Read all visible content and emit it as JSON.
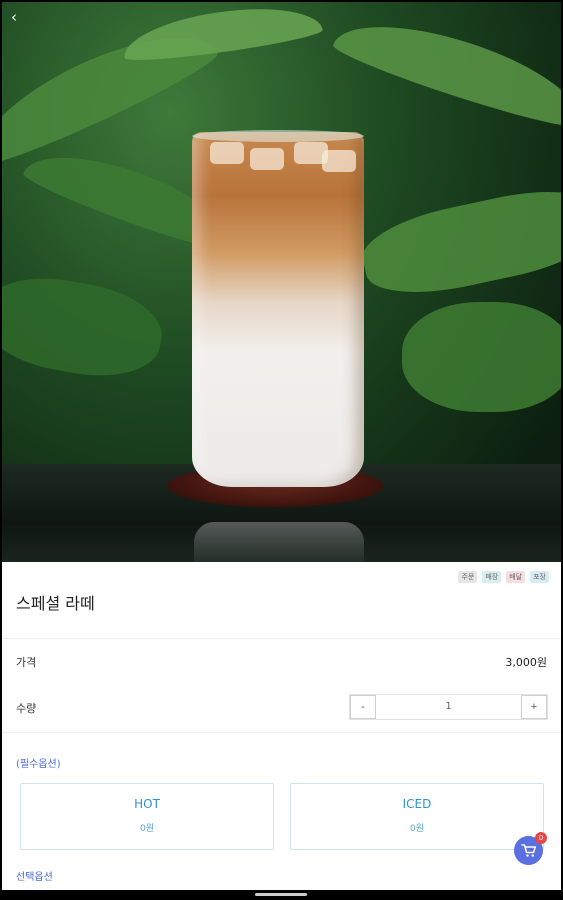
{
  "product": {
    "image_alt": "iced latte photo",
    "title": "스페셜 라떼",
    "tags": [
      "주문",
      "매장",
      "배달",
      "포장"
    ]
  },
  "price_row": {
    "label": "가격",
    "value": "3,000원"
  },
  "quantity_row": {
    "label": "수량",
    "minus": "-",
    "value": "1",
    "plus": "+"
  },
  "required_options": {
    "label": "(필수옵션)",
    "items": [
      {
        "name": "HOT",
        "price": "0원"
      },
      {
        "name": "ICED",
        "price": "0원"
      }
    ]
  },
  "optional_options": {
    "label": "선택옵션"
  },
  "cart": {
    "count": "0"
  },
  "nav": {
    "back": "‹"
  },
  "colors": {
    "accent": "#5a6fe0",
    "option_text": "#2f95c9",
    "section_label": "#4a6bd6"
  }
}
